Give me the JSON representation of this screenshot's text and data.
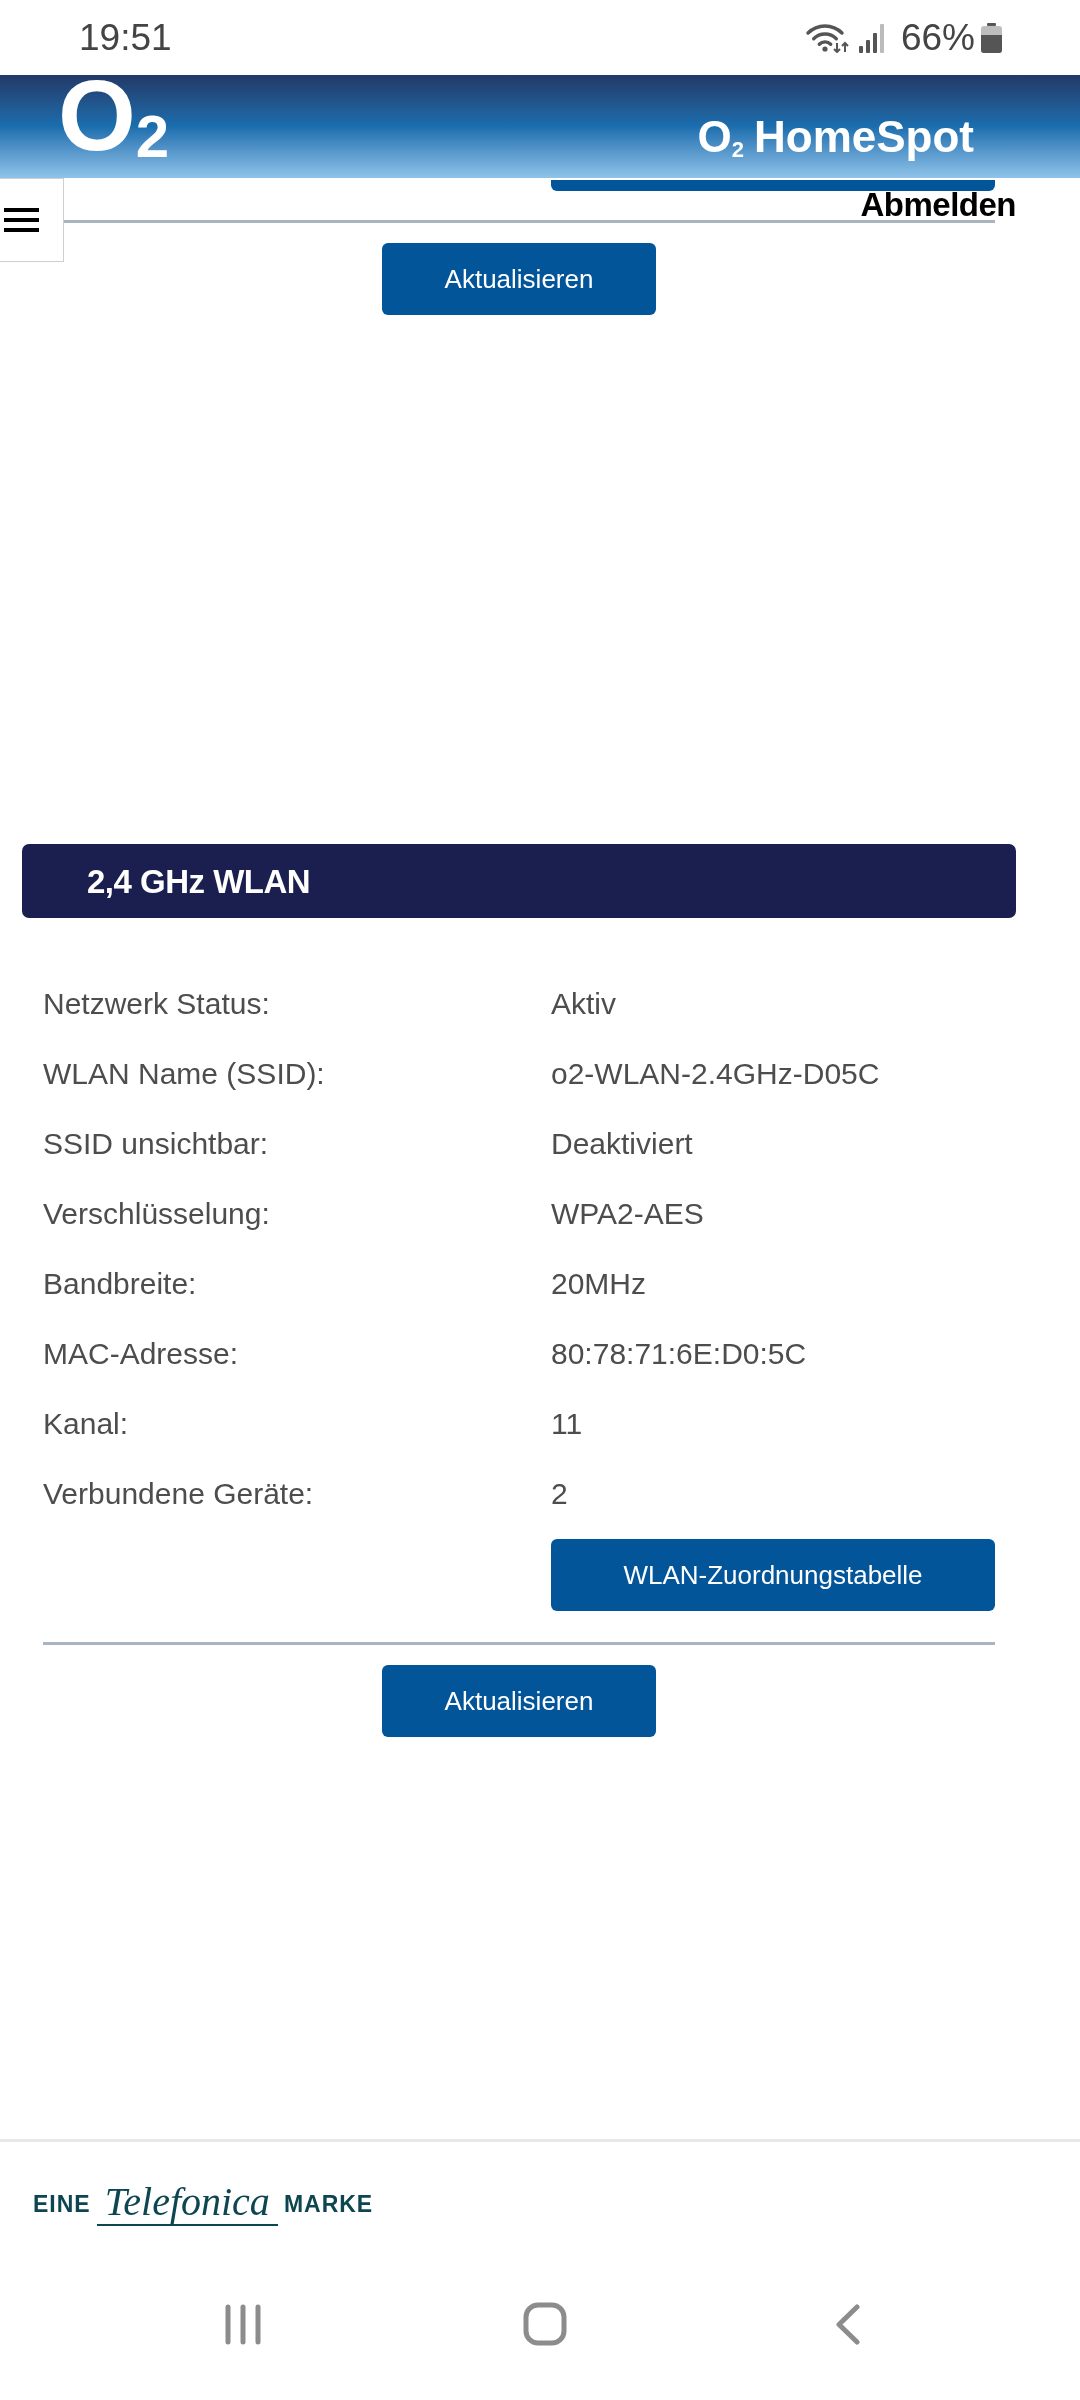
{
  "status_bar": {
    "time": "19:51",
    "battery": "66%"
  },
  "header": {
    "logo": "O$_{2}$",
    "title": "O$_{2}$ HomeSpot"
  },
  "top_panel": {
    "logout_link": "Abmelden",
    "refresh_button": "Aktualisieren"
  },
  "wlan_section": {
    "title": "2,4 GHz WLAN",
    "rows": [
      {
        "label": "Netzwerk Status:",
        "value": "Aktiv"
      },
      {
        "label": "WLAN Name (SSID):",
        "value": "o2-WLAN-2.4GHz-D05C"
      },
      {
        "label": "SSID unsichtbar:",
        "value": "Deaktiviert"
      },
      {
        "label": "Verschlüsselung:",
        "value": "WPA2-AES"
      },
      {
        "label": "Bandbreite:",
        "value": "20MHz"
      },
      {
        "label": "MAC-Adresse:",
        "value": "80:78:71:6E:D0:5C"
      },
      {
        "label": "Kanal:",
        "value": "11"
      },
      {
        "label": "Verbundene Geräte:",
        "value": "2"
      }
    ],
    "table_button": "WLAN-Zuordnungstabelle",
    "refresh_button": "Aktualisieren"
  },
  "footer": {
    "brand_prefix": "EINE",
    "brand_name": "Telefonica",
    "brand_suffix": "MARKE"
  }
}
